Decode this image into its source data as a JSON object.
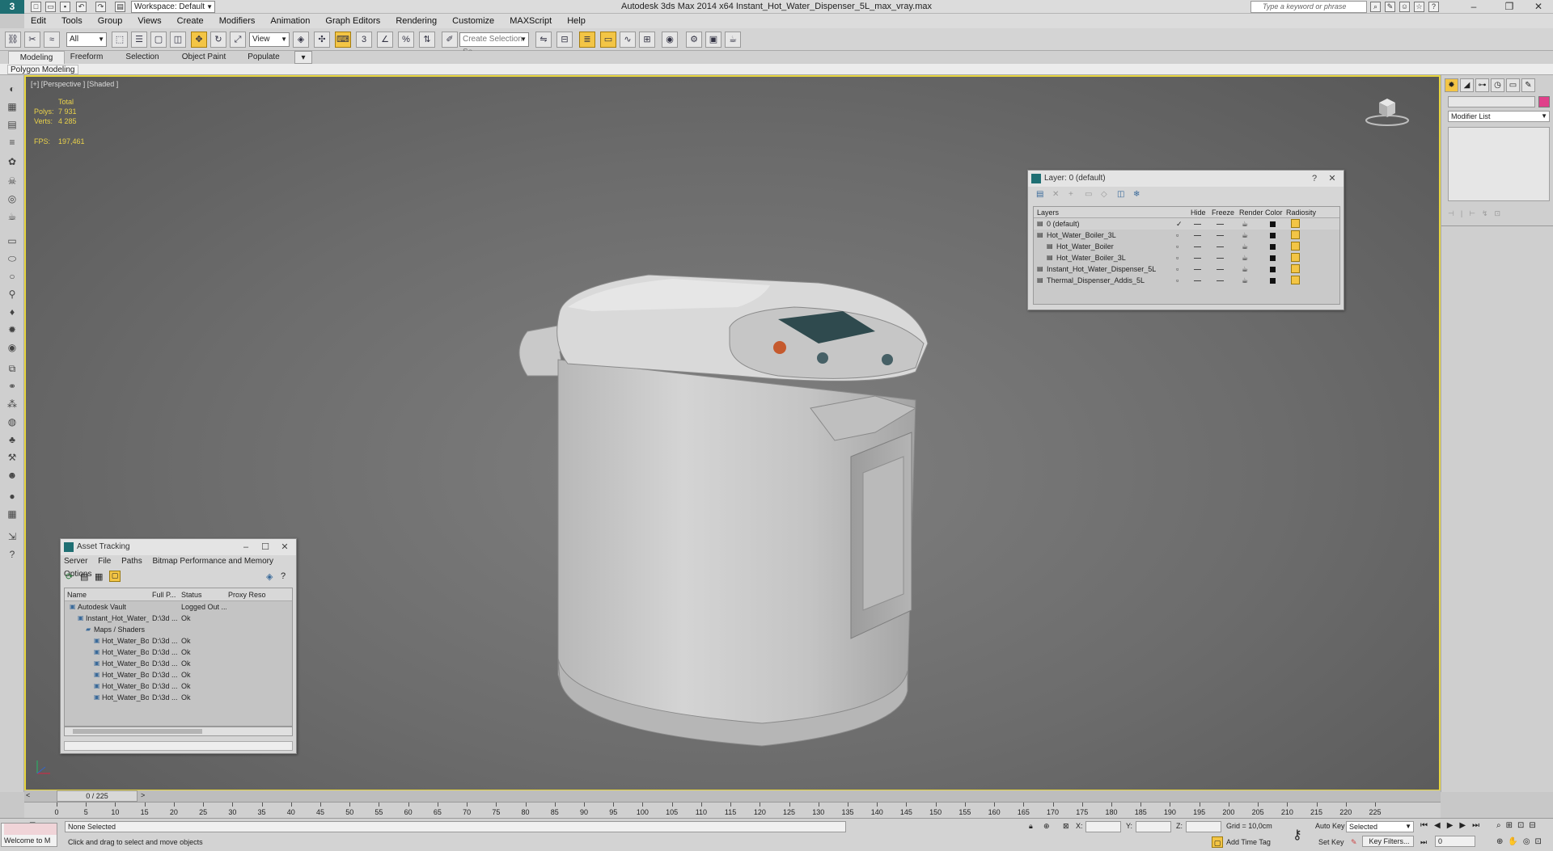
{
  "app": {
    "window_title": "Autodesk 3ds Max  2014 x64     Instant_Hot_Water_Dispenser_5L_max_vray.max",
    "workspace": "Workspace: Default",
    "search_placeholder": "Type a keyword or phrase",
    "logo": "3"
  },
  "menu": [
    "Edit",
    "Tools",
    "Group",
    "Views",
    "Create",
    "Modifiers",
    "Animation",
    "Graph Editors",
    "Rendering",
    "Customize",
    "MAXScript",
    "Help"
  ],
  "toolbar": {
    "selection_filter": "All",
    "reference_coord": "View",
    "named_selection_placeholder": "Create Selection Se"
  },
  "ribbon": {
    "tabs": [
      "Modeling",
      "Freeform",
      "Selection",
      "Object Paint",
      "Populate"
    ],
    "sub": "Polygon Modeling"
  },
  "viewport": {
    "label": "[+] [Perspective ] [Shaded ]",
    "stats": {
      "total_label": "Total",
      "polys_label": "Polys:",
      "polys": "7 931",
      "verts_label": "Verts:",
      "verts": "4 285",
      "fps_label": "FPS:",
      "fps": "197,461"
    }
  },
  "layer_dialog": {
    "title": "Layer: 0 (default)",
    "help": "?",
    "columns": [
      "Layers",
      "Hide",
      "Freeze",
      "Render",
      "Color",
      "Radiosity"
    ],
    "rows": [
      {
        "name": "0 (default)",
        "indent": 0,
        "active": true
      },
      {
        "name": "Hot_Water_Boiler_3L",
        "indent": 0,
        "active": false
      },
      {
        "name": "Hot_Water_Boiler",
        "indent": 1,
        "active": false
      },
      {
        "name": "Hot_Water_Boiler_3L",
        "indent": 1,
        "active": false
      },
      {
        "name": "Instant_Hot_Water_Dispenser_5L",
        "indent": 0,
        "active": false
      },
      {
        "name": "Thermal_Dispenser_Addis_5L",
        "indent": 0,
        "active": false
      }
    ]
  },
  "asset_dialog": {
    "title": "Asset Tracking",
    "menu": [
      "Server",
      "File",
      "Paths",
      "Bitmap Performance and Memory",
      "Options"
    ],
    "columns": [
      "Name",
      "Full P...",
      "Status",
      "Proxy Reso"
    ],
    "rows": [
      {
        "name": "Autodesk Vault",
        "path": "",
        "status": "Logged Out ...",
        "indent": 0
      },
      {
        "name": "Instant_Hot_Water_...",
        "path": "D:\\3d ...",
        "status": "Ok",
        "indent": 1
      },
      {
        "name": "Maps / Shaders",
        "path": "",
        "status": "",
        "indent": 2
      },
      {
        "name": "Hot_Water_Bo...",
        "path": "D:\\3d ...",
        "status": "Ok",
        "indent": 3
      },
      {
        "name": "Hot_Water_Bo...",
        "path": "D:\\3d ...",
        "status": "Ok",
        "indent": 3
      },
      {
        "name": "Hot_Water_Bo...",
        "path": "D:\\3d ...",
        "status": "Ok",
        "indent": 3
      },
      {
        "name": "Hot_Water_Bo...",
        "path": "D:\\3d ...",
        "status": "Ok",
        "indent": 3
      },
      {
        "name": "Hot_Water_Bo...",
        "path": "D:\\3d ...",
        "status": "Ok",
        "indent": 3
      },
      {
        "name": "Hot_Water_Bo...",
        "path": "D:\\3d ...",
        "status": "Ok",
        "indent": 3
      }
    ]
  },
  "command_panel": {
    "modifier_list": "Modifier List",
    "accent": "#e0408a"
  },
  "timeline": {
    "slider": "0 / 225",
    "ticks": [
      "0",
      "5",
      "10",
      "15",
      "20",
      "25",
      "30",
      "35",
      "40",
      "45",
      "50",
      "55",
      "60",
      "65",
      "70",
      "75",
      "80",
      "85",
      "90",
      "95",
      "100",
      "105",
      "110",
      "115",
      "120",
      "125",
      "130",
      "135",
      "140",
      "145",
      "150",
      "155",
      "160",
      "165",
      "170",
      "175",
      "180",
      "185",
      "190",
      "195",
      "200",
      "205",
      "210",
      "215",
      "220",
      "225"
    ]
  },
  "status": {
    "maxscript": "Welcome to M",
    "selection": "None Selected",
    "prompt": "Click and drag to select and move objects",
    "x_label": "X:",
    "y_label": "Y:",
    "z_label": "Z:",
    "grid": "Grid = 10,0cm",
    "add_time_tag": "Add Time Tag",
    "auto_key": "Auto Key",
    "selected": "Selected",
    "set_key": "Set Key",
    "key_filters": "Key Filters...",
    "frame": "0"
  }
}
